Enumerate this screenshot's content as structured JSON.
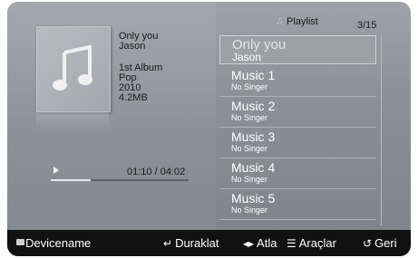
{
  "now_playing": {
    "title": "Only you",
    "artist": "Jason",
    "album": "1st Album",
    "genre": "Pop",
    "year": "2010",
    "size": "4.2MB",
    "time": "01:10 / 04:02",
    "progress": 0.29
  },
  "playlist": {
    "header": "Playlist",
    "counter": "3/15",
    "items": [
      {
        "title": "Only you",
        "artist": "Jason",
        "selected": true
      },
      {
        "title": "Music 1",
        "artist": "No Singer"
      },
      {
        "title": "Music 2",
        "artist": "No Singer"
      },
      {
        "title": "Music 3",
        "artist": "No Singer"
      },
      {
        "title": "Music 4",
        "artist": "No Singer"
      },
      {
        "title": "Music 5",
        "artist": "No Singer"
      }
    ]
  },
  "bottom_bar": {
    "device": "Devicename",
    "pause": "Duraklat",
    "skip": "Atla",
    "tools": "Araçlar",
    "back": "Geri"
  }
}
